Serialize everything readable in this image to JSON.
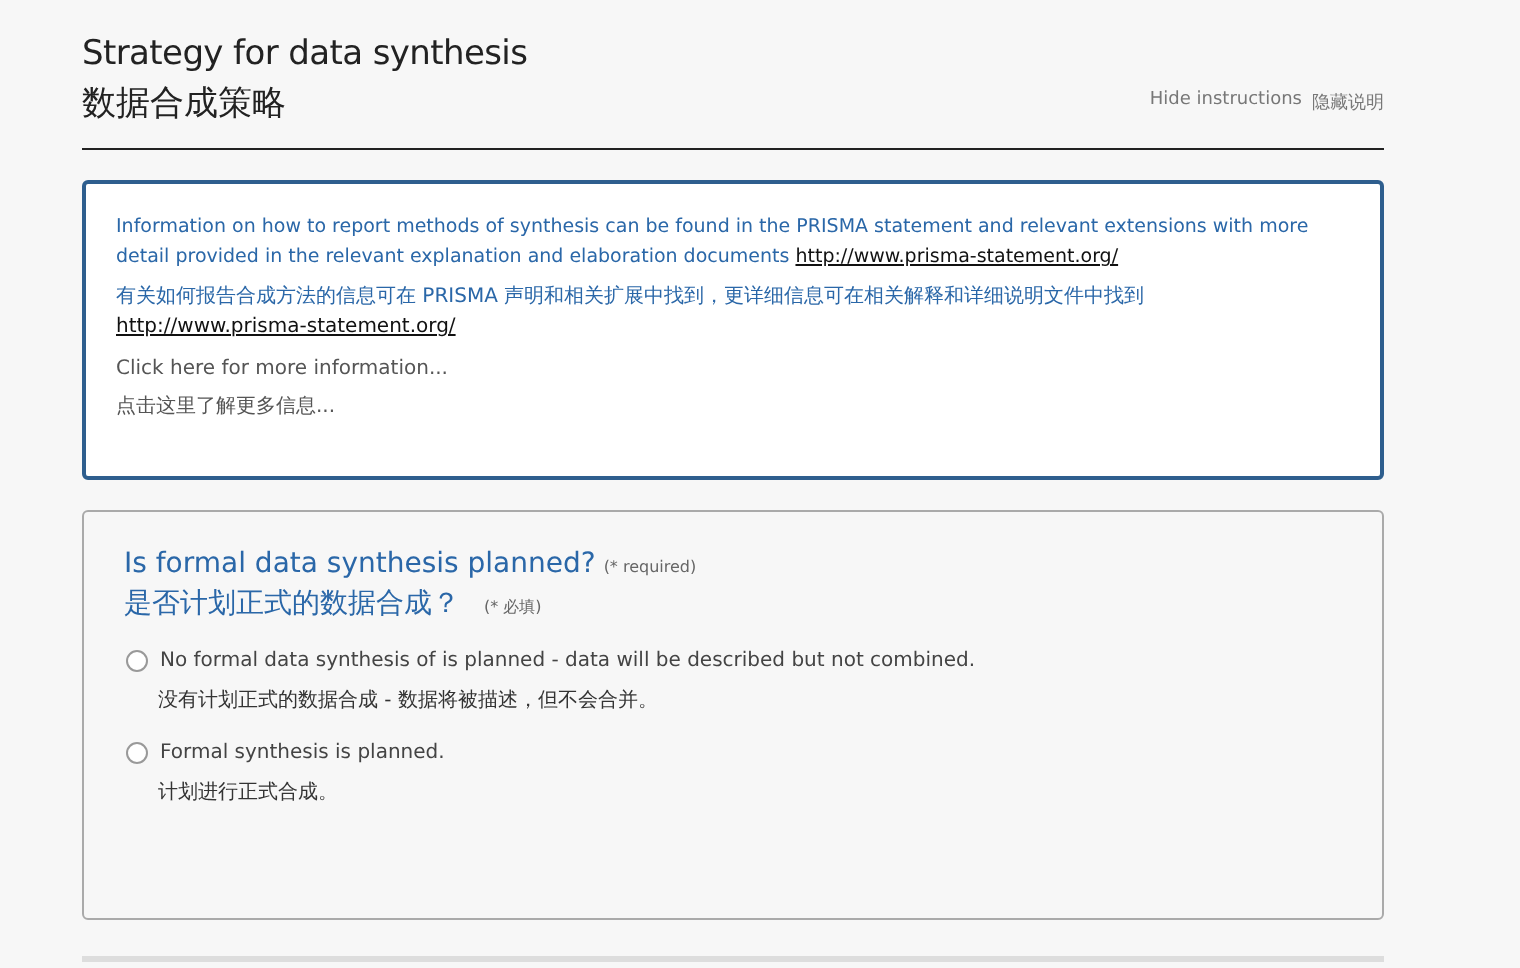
{
  "header": {
    "title": "Strategy for data synthesis",
    "title_zh": "数据合成策略",
    "hide_link": "Hide instructions",
    "hide_link_zh": "隐藏说明"
  },
  "instructions": {
    "paragraphs": [
      {
        "text": "Information on how to report methods of synthesis can be found in the PRISMA statement and relevant extensions with more detail provided in the relevant explanation and elaboration documents",
        "link": "http://www.prisma-statement.org/"
      },
      {
        "text": "有关如何报告合成方法的信息可在 PRISMA 声明和相关扩展中找到，更详细信息可在相关解释和详细说明文件中找到",
        "link": "http://www.prisma-statement.org/"
      }
    ],
    "more": "Click here for more information...",
    "more_zh": "点击这里了解更多信息..."
  },
  "question": {
    "title": "Is formal data synthesis planned?",
    "required": "(* required)",
    "title_zh": "是否计划正式的数据合成？",
    "required_zh": "(* 必填)",
    "options": [
      {
        "label": "No formal data synthesis of is planned - data will be described but not combined.",
        "label_zh": "没有计划正式的数据合成 - 数据将被描述，但不会合并。",
        "selected": false
      },
      {
        "label": "Formal synthesis is planned.",
        "label_zh": "计划进行正式合成。",
        "selected": false
      }
    ]
  }
}
